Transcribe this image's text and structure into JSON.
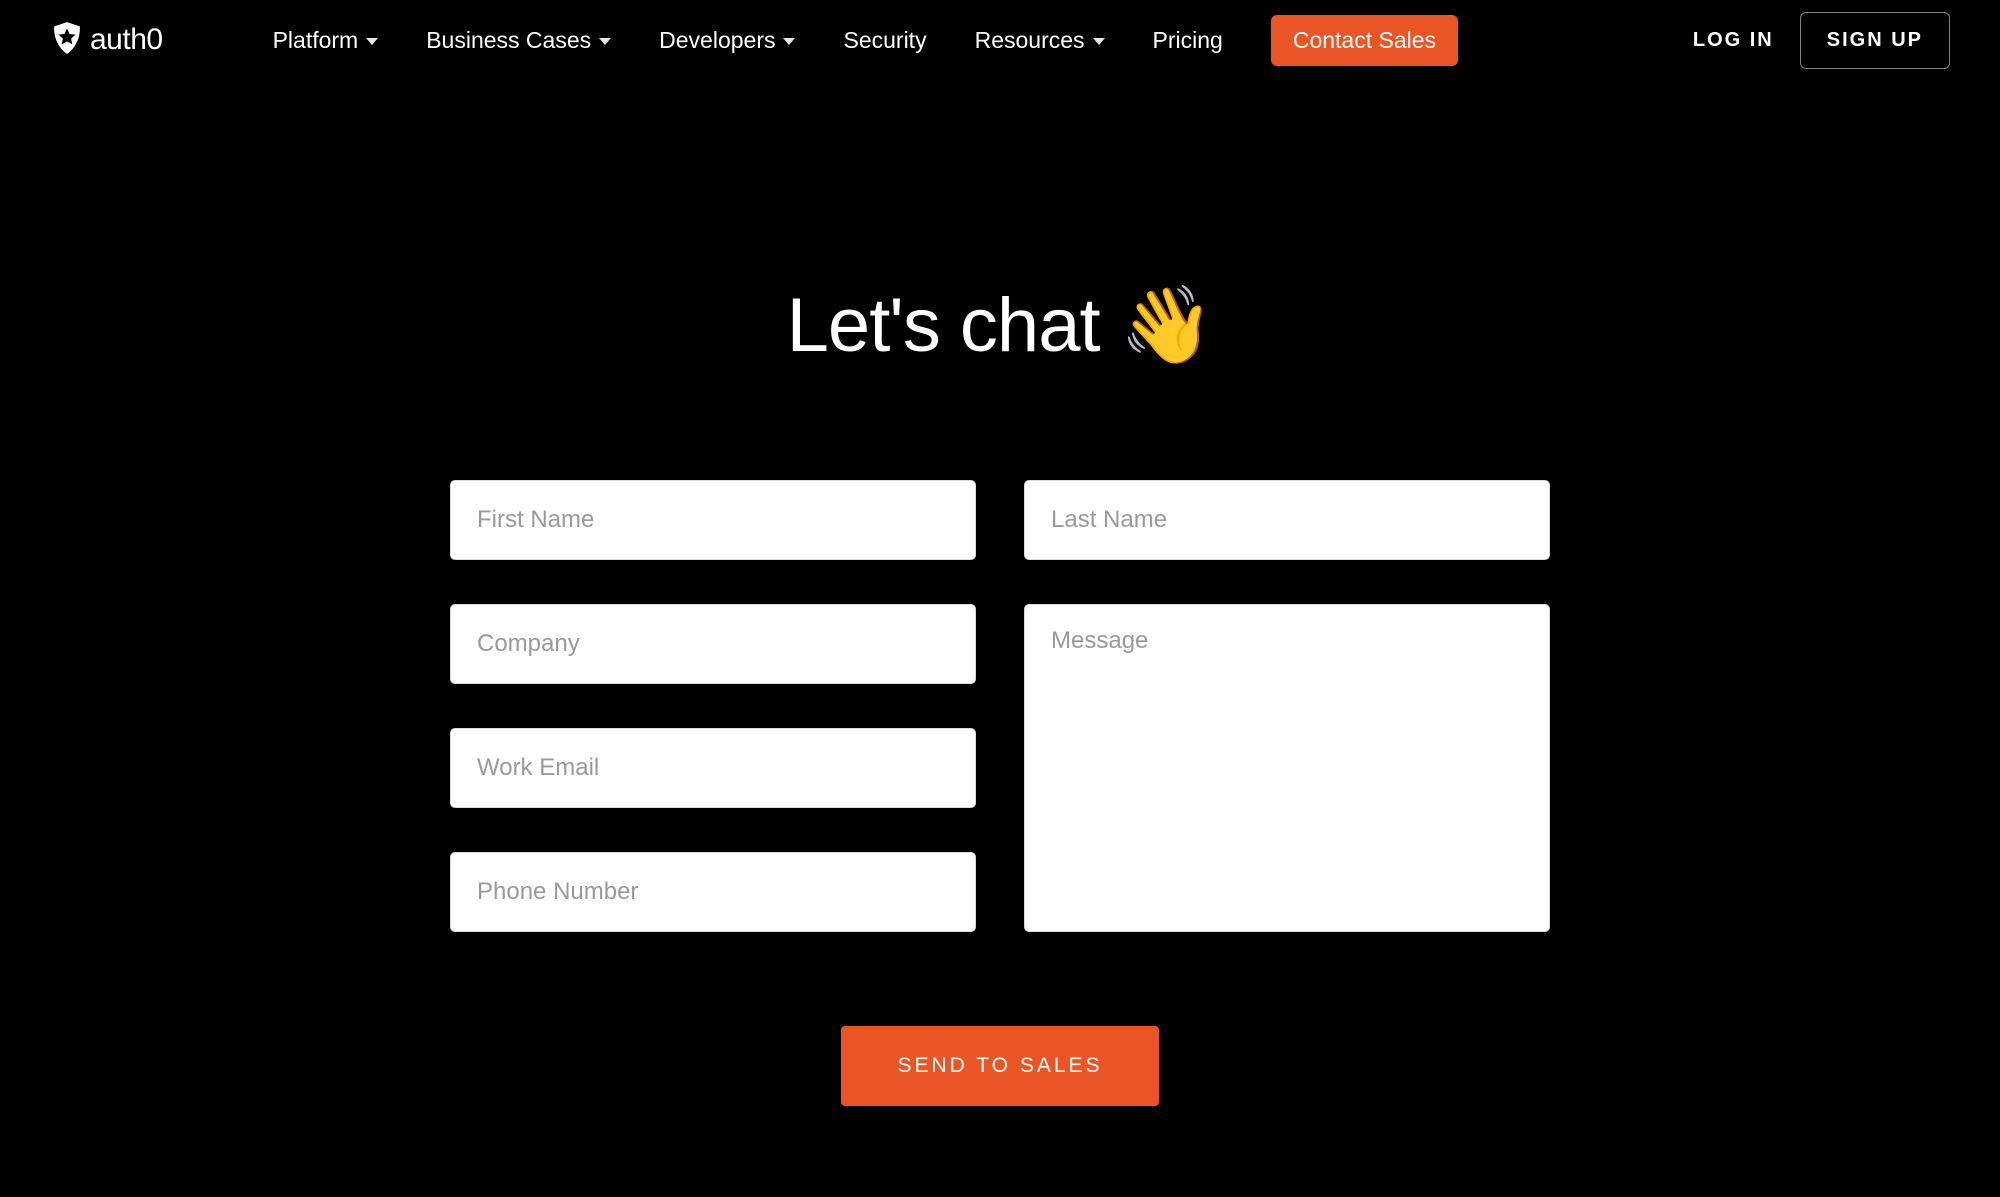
{
  "brand": {
    "name": "auth0"
  },
  "nav": {
    "platform": "Platform",
    "business_cases": "Business Cases",
    "developers": "Developers",
    "security": "Security",
    "resources": "Resources",
    "pricing": "Pricing",
    "contact_sales": "Contact Sales"
  },
  "auth": {
    "login": "LOG IN",
    "signup": "SIGN UP"
  },
  "hero": {
    "title": "Let's chat 👋"
  },
  "form": {
    "first_name_ph": "First Name",
    "last_name_ph": "Last Name",
    "company_ph": "Company",
    "work_email_ph": "Work Email",
    "phone_ph": "Phone Number",
    "message_ph": "Message",
    "submit_label": "SEND TO SALES"
  },
  "colors": {
    "accent": "#EB5424",
    "bg": "#000000"
  }
}
